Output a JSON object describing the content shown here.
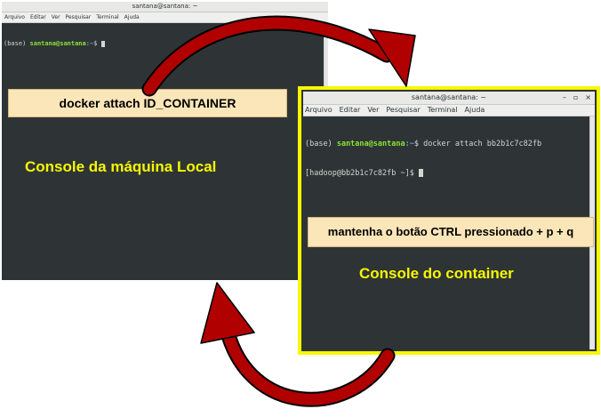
{
  "local_terminal": {
    "title": "santana@santana: ~",
    "menu": [
      "Arquivo",
      "Editar",
      "Ver",
      "Pesquisar",
      "Terminal",
      "Ajuda"
    ],
    "lines": [
      {
        "env": "(base) ",
        "user": "santana@santana",
        "path": ":~",
        "rest": "$ "
      }
    ]
  },
  "container_terminal": {
    "title": "santana@santana: ~",
    "window_buttons": [
      "–",
      "▫",
      "×"
    ],
    "menu": [
      "Arquivo",
      "Editar",
      "Ver",
      "Pesquisar",
      "Terminal",
      "Ajuda"
    ],
    "line1": {
      "env": "(base) ",
      "user": "santana@santana",
      "path": ":~",
      "rest": "$ docker attach bb2b1c7c82fb"
    },
    "line2": "[hadoop@bb2b1c7c82fb ~]$ "
  },
  "notes": {
    "attach": "docker attach ID_CONTAINER",
    "ctrl": "mantenha o botão CTRL pressionado + p + q"
  },
  "captions": {
    "local": "Console da máquina Local",
    "container": "Console do container"
  },
  "colors": {
    "arrow": "#b00000",
    "highlight": "#f7f700",
    "terminal_bg": "#2e3436",
    "note_bg": "#fbe6b9"
  }
}
